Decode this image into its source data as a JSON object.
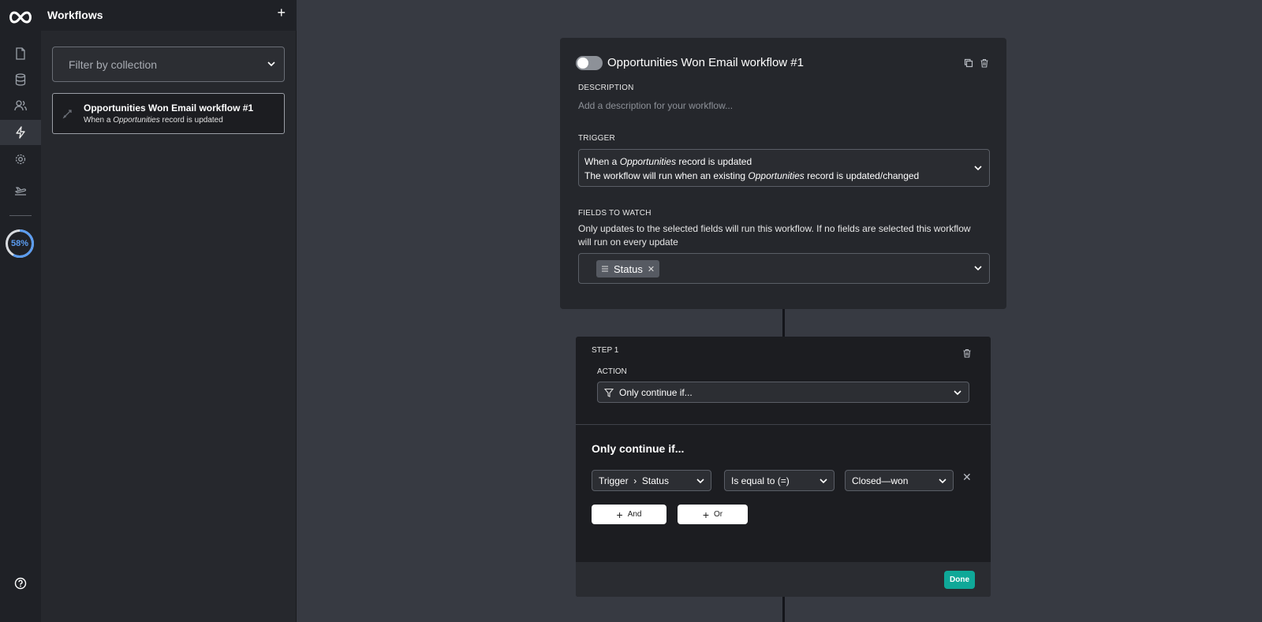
{
  "colors": {
    "accent": "#0fa898",
    "progress": "#5b9cf0",
    "background": "#373a42",
    "card": "#25272c"
  },
  "rail": {
    "icons": [
      "logo-icon",
      "document-icon",
      "database-icon",
      "users-icon",
      "lightning-icon",
      "gear-icon",
      "plane-icon",
      "help-icon"
    ],
    "active": "lightning-icon",
    "progress_label": "58%",
    "progress_value": 0.58
  },
  "panel": {
    "title": "Workflows",
    "add_label": "+",
    "filter_placeholder": "Filter by collection",
    "items": [
      {
        "title": "Opportunities Won Email workflow #1",
        "sub_prefix": "When a ",
        "sub_collection": "Opportunities",
        "sub_suffix": " record is updated"
      }
    ]
  },
  "workflow": {
    "title": "Opportunities Won Email workflow #1",
    "enabled": false,
    "description_label": "DESCRIPTION",
    "description_placeholder": "Add a description for your workflow...",
    "trigger_label": "TRIGGER",
    "trigger": {
      "l1_prefix": "When a ",
      "l1_collection": "Opportunities",
      "l1_suffix": " record is updated",
      "l2_prefix": "The workflow will run when an existing ",
      "l2_collection": "Opportunities",
      "l2_suffix": " record is updated/changed"
    },
    "fields_label": "FIELDS TO WATCH",
    "fields_help": "Only updates to the selected fields will run this workflow. If no fields are selected this workflow will run on every update",
    "fields": [
      "Status"
    ]
  },
  "step": {
    "label": "STEP 1",
    "action_label": "ACTION",
    "action_value": "Only continue if...",
    "condition_title": "Only continue if...",
    "condition": {
      "field_prefix": "Trigger",
      "field_sep": "›",
      "field": "Status",
      "operator": "Is equal to (=)",
      "value": "Closed—won",
      "remove": "✕"
    },
    "and_label": "And",
    "or_label": "Or",
    "done_label": "Done"
  }
}
